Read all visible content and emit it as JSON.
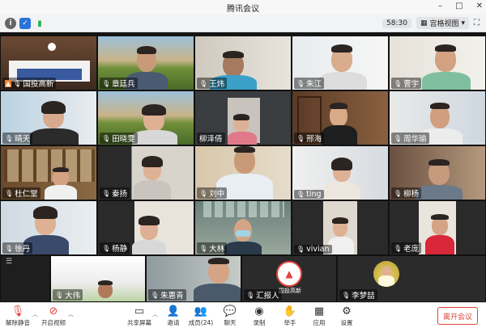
{
  "window": {
    "title": "腾讯会议"
  },
  "toolbar": {
    "timer": "58:30",
    "view_label": "宫格视图"
  },
  "participants": [
    {
      "name": "国投高新"
    },
    {
      "name": "章廷兵"
    },
    {
      "name": "王炜"
    },
    {
      "name": "朱江"
    },
    {
      "name": "曹宇"
    },
    {
      "name": "晴天"
    },
    {
      "name": "田晓雯"
    },
    {
      "name": "柳泽倩"
    },
    {
      "name": "邢海"
    },
    {
      "name": "周华瑜"
    },
    {
      "name": "杜仁堂"
    },
    {
      "name": "秦扬"
    },
    {
      "name": "刘中"
    },
    {
      "name": "ting"
    },
    {
      "name": "柳杨"
    },
    {
      "name": "徐丹"
    },
    {
      "name": "杨静"
    },
    {
      "name": "大林"
    },
    {
      "name": "vivian"
    },
    {
      "name": "老庞"
    },
    {
      "name": "大伟"
    },
    {
      "name": "朱惠青"
    },
    {
      "name": "汇报人"
    },
    {
      "name": "李梦喆"
    }
  ],
  "logo_text": "国投高新",
  "controls": {
    "unmute": "解除静音",
    "start_video": "开启视频",
    "share_screen": "共享屏幕",
    "invite": "邀请",
    "members": "成员(24)",
    "chat": "聊天",
    "record": "录制",
    "raise_hand": "举手",
    "apps": "应用",
    "settings": "设置",
    "leave": "离开会议"
  },
  "colors": {
    "accent_red": "#e0433b",
    "brand_blue": "#2a73d9"
  }
}
